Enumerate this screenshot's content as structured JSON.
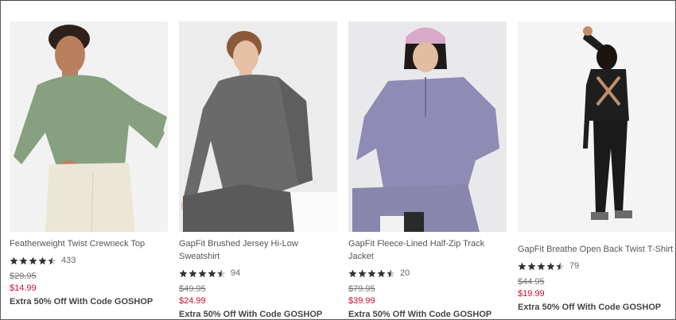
{
  "products": [
    {
      "name": "Featherweight Twist Crewneck Top",
      "rating": 4.5,
      "reviews": "433",
      "was_price": "$29.95",
      "sale_price": "$14.99",
      "promo": "Extra 50% Off With Code GOSHOP",
      "colors": {
        "bg": "#f2f2f2",
        "top": "#86a080",
        "bottom": "#ece6d6",
        "skin": "#b8805f",
        "hair": "#2d2119"
      }
    },
    {
      "name": "GapFit Brushed Jersey Hi-Low Sweatshirt",
      "rating": 4.5,
      "reviews": "94",
      "was_price": "$49.95",
      "sale_price": "$24.99",
      "promo": "Extra 50% Off With Code GOSHOP",
      "colors": {
        "bg": "#ececec",
        "top": "#6a6a6a",
        "bottom": "#5a5a5a",
        "skin": "#e6c0a4",
        "hair": "#8c5a3a"
      }
    },
    {
      "name": "GapFit Fleece-Lined Half-Zip Track Jacket",
      "rating": 4.5,
      "reviews": "20",
      "was_price": "$79.95",
      "sale_price": "$39.99",
      "promo": "Extra 50% Off With Code GOSHOP",
      "colors": {
        "bg": "#e9e9ec",
        "top": "#8e8cb4",
        "bottom": "#8886ad",
        "skin": "#e3bda1",
        "hair": "#1e1a1a",
        "hat": "#d9a9c9"
      }
    },
    {
      "name": "GapFit Breathe Open Back Twist T-Shirt",
      "rating": 4.5,
      "reviews": "79",
      "was_price": "$44.95",
      "sale_price": "$19.99",
      "promo": "Extra 50% Off With Code GOSHOP",
      "colors": {
        "bg": "#f4f4f4",
        "top": "#1e1e1e",
        "bottom": "#1a1a1a",
        "skin": "#c28f6c",
        "hair": "#1b1410"
      }
    }
  ],
  "star_icon": "star-icon",
  "half_star_icon": "half-star-icon"
}
